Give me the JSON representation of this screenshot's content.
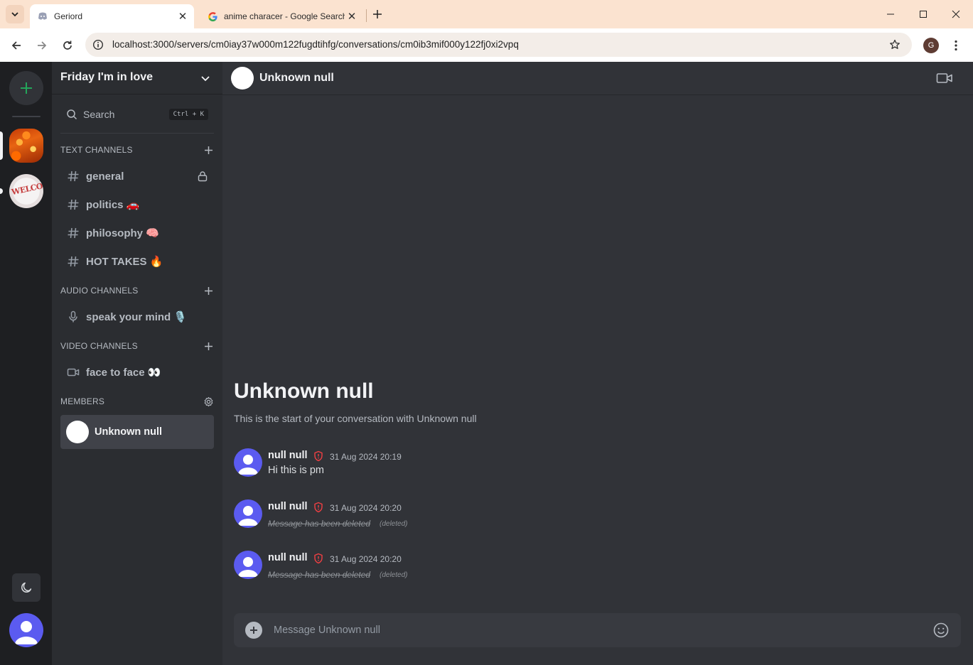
{
  "browser": {
    "tabs": [
      {
        "title": "Geriord",
        "active": true
      },
      {
        "title": "anime characer - Google Search",
        "active": false
      }
    ],
    "url": "localhost:3000/servers/cm0iay37w000m122fugdtihfg/conversations/cm0ib3mif000y122fj0xi2vpq",
    "profile_initial": "G"
  },
  "server": {
    "name": "Friday I'm in love",
    "search_label": "Search",
    "search_shortcut": "Ctrl + K"
  },
  "sections": {
    "text": "TEXT CHANNELS",
    "audio": "AUDIO CHANNELS",
    "video": "VIDEO CHANNELS",
    "members": "MEMBERS"
  },
  "channels": {
    "text": [
      {
        "name": "general",
        "locked": true
      },
      {
        "name": "politics 🚗"
      },
      {
        "name": "philosophy 🧠"
      },
      {
        "name": "HOT TAKES 🔥"
      }
    ],
    "audio": [
      {
        "name": "speak your mind 🎙️"
      }
    ],
    "video": [
      {
        "name": "face to face 👀"
      }
    ]
  },
  "members": [
    {
      "name": "Unknown null"
    }
  ],
  "conversation": {
    "title": "Unknown null",
    "welcome_title": "Unknown null",
    "welcome_subtitle": "This is the start of your conversation with Unknown null",
    "messages": [
      {
        "author": "null null",
        "timestamp": "31 Aug 2024 20:19",
        "text": "Hi this is pm",
        "deleted": false
      },
      {
        "author": "null null",
        "timestamp": "31 Aug 2024 20:20",
        "text": "Message has been deleted",
        "deleted": true,
        "deleted_tag": "(deleted)"
      },
      {
        "author": "null null",
        "timestamp": "31 Aug 2024 20:20",
        "text": "Message has been deleted",
        "deleted": true,
        "deleted_tag": "(deleted)"
      }
    ],
    "composer_placeholder": "Message Unknown null"
  },
  "colors": {
    "accent": "#23a55a",
    "avatar": "#5b5bf0",
    "moderator_shield": "#f23f43"
  }
}
